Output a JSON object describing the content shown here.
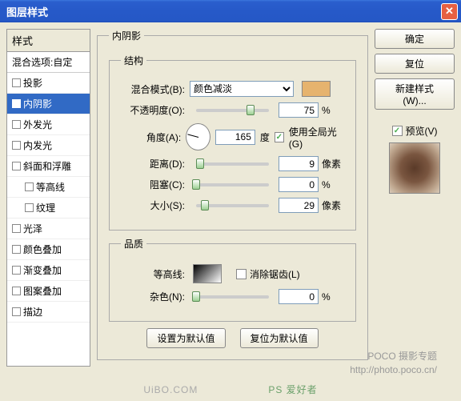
{
  "window": {
    "title": "图层样式"
  },
  "left": {
    "header": "样式",
    "blending": "混合选项:自定",
    "items": [
      {
        "label": "投影",
        "checked": false
      },
      {
        "label": "内阴影",
        "checked": true,
        "selected": true
      },
      {
        "label": "外发光",
        "checked": false
      },
      {
        "label": "内发光",
        "checked": false
      },
      {
        "label": "斜面和浮雕",
        "checked": false
      },
      {
        "label": "等高线",
        "checked": false,
        "indent": true
      },
      {
        "label": "纹理",
        "checked": false,
        "indent": true
      },
      {
        "label": "光泽",
        "checked": false
      },
      {
        "label": "颜色叠加",
        "checked": false
      },
      {
        "label": "渐变叠加",
        "checked": false
      },
      {
        "label": "图案叠加",
        "checked": false
      },
      {
        "label": "描边",
        "checked": false
      }
    ]
  },
  "center": {
    "effect_title": "内阴影",
    "structure_title": "结构",
    "blend_mode_label": "混合模式(B):",
    "blend_mode_value": "颜色减淡",
    "color": "#E6B36E",
    "opacity_label": "不透明度(O):",
    "opacity_value": "75",
    "opacity_unit": "%",
    "angle_label": "角度(A):",
    "angle_value": "165",
    "angle_unit": "度",
    "global_light_label": "使用全局光(G)",
    "distance_label": "距离(D):",
    "distance_value": "9",
    "distance_unit": "像素",
    "choke_label": "阻塞(C):",
    "choke_value": "0",
    "choke_unit": "%",
    "size_label": "大小(S):",
    "size_value": "29",
    "size_unit": "像素",
    "quality_title": "品质",
    "contour_label": "等高线:",
    "antialias_label": "消除锯齿(L)",
    "noise_label": "杂色(N):",
    "noise_value": "0",
    "noise_unit": "%",
    "make_default": "设置为默认值",
    "reset_default": "复位为默认值"
  },
  "right": {
    "ok": "确定",
    "cancel": "复位",
    "new_style": "新建样式(W)...",
    "preview_label": "预览(V)"
  },
  "watermark": {
    "brand": "POCO 摄影专题",
    "url": "http://photo.poco.cn/",
    "footer": "UiBO.COM",
    "ps": "PS 爱好者"
  }
}
